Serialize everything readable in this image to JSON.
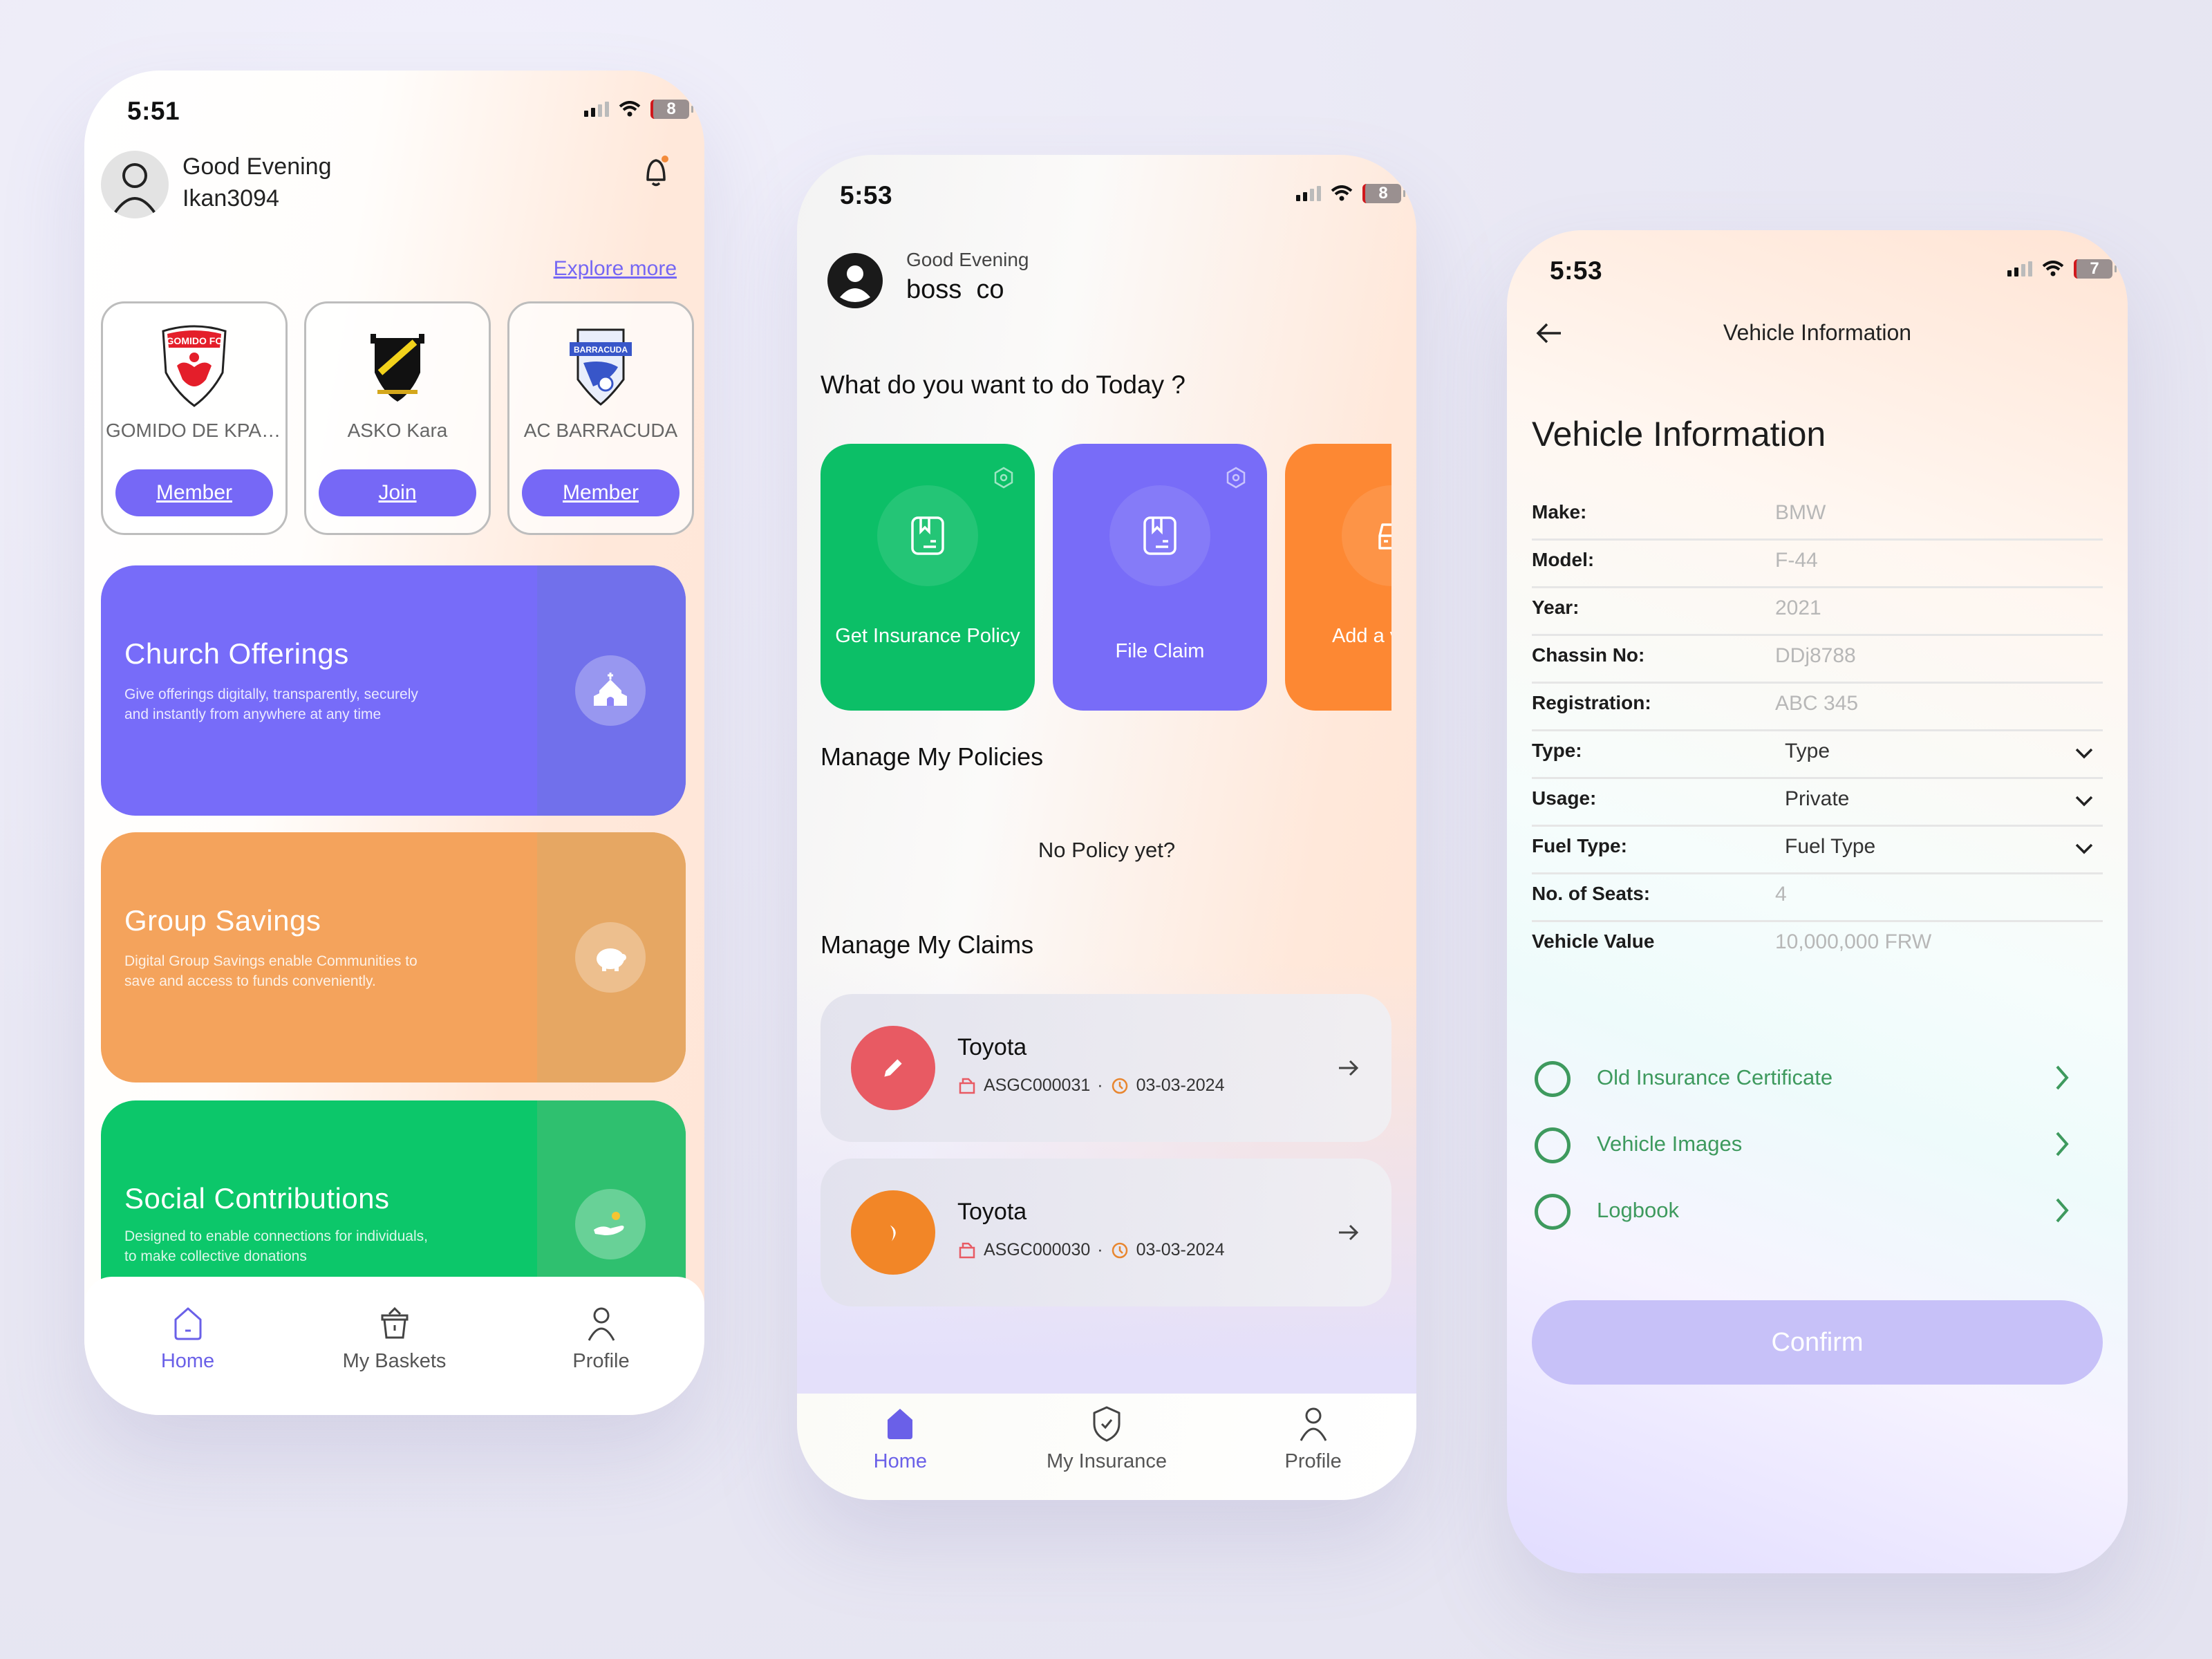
{
  "colors": {
    "accent_purple": "#7668f6",
    "green": "#0cc76a",
    "orange": "#f4a35c",
    "orange_action": "#fd8833",
    "claim_red": "#e85a63",
    "claim_orange": "#f28627",
    "doc_green": "#3e9a5e",
    "confirm_disabled": "#c7c1f8"
  },
  "phone1": {
    "status": {
      "time": "5:51",
      "battery": "8"
    },
    "greeting": "Good Evening",
    "username": "Ikan3094",
    "icons": {
      "avatar": "user-icon",
      "notifications": "bell-icon"
    },
    "explore_more": "Explore more",
    "teams": [
      {
        "name": "GOMIDO DE KPALIME",
        "action": "Member",
        "logo": "gomido-fc-logo"
      },
      {
        "name": "ASKO Kara",
        "action": "Join",
        "logo": "asko-kara-logo"
      },
      {
        "name": "AC BARRACUDA",
        "action": "Member",
        "logo": "ac-barracuda-logo"
      }
    ],
    "features": [
      {
        "title": "Church Offerings",
        "description": "Give offerings digitally, transparently, securely and instantly from anywhere at any time",
        "icon": "church-icon"
      },
      {
        "title": "Group Savings",
        "description": "Digital Group Savings enable Communities to save and access to funds conveniently.",
        "icon": "piggy-bank-icon"
      },
      {
        "title": "Social Contributions",
        "description": "Designed to enable connections for individuals, to make collective donations",
        "icon": "hand-coin-icon"
      }
    ],
    "tabs": [
      {
        "label": "Home",
        "icon": "home-icon",
        "active": true
      },
      {
        "label": "My Baskets",
        "icon": "basket-icon",
        "active": false
      },
      {
        "label": "Profile",
        "icon": "profile-icon",
        "active": false
      }
    ]
  },
  "phone2": {
    "status": {
      "time": "5:53",
      "battery": "8"
    },
    "greeting": "Good Evening",
    "username": "boss  co",
    "question": "What do you want to do Today ?",
    "actions": [
      {
        "label": "Get Insurance Policy",
        "icon": "document-bookmark-icon"
      },
      {
        "label": "File Claim",
        "icon": "document-bookmark-icon"
      },
      {
        "label": "Add a vehicle",
        "icon": "car-icon"
      }
    ],
    "policies_title": "Manage My Policies",
    "policies_empty": "No Policy yet?",
    "claims_title": "Manage My Claims",
    "claims": [
      {
        "vehicle": "Toyota",
        "code": "ASGC000031",
        "date": "03-03-2024",
        "status_icon": "pencil-icon"
      },
      {
        "vehicle": "Toyota",
        "code": "ASGC000030",
        "date": "03-03-2024",
        "status_icon": "pending-icon"
      }
    ],
    "tabs": [
      {
        "label": "Home",
        "icon": "home-icon",
        "active": true
      },
      {
        "label": "My Insurance",
        "icon": "shield-check-icon",
        "active": false
      },
      {
        "label": "Profile",
        "icon": "profile-icon",
        "active": false
      }
    ]
  },
  "phone3": {
    "status": {
      "time": "5:53",
      "battery": "7"
    },
    "nav_title": "Vehicle Information",
    "page_title": "Vehicle Information",
    "fields": [
      {
        "label": "Make:",
        "value": "BMW",
        "type": "text"
      },
      {
        "label": "Model:",
        "value": "F-44",
        "type": "text"
      },
      {
        "label": "Year:",
        "value": "2021",
        "type": "text"
      },
      {
        "label": "Chassin No:",
        "value": "DDj8788",
        "type": "text"
      },
      {
        "label": "Registration:",
        "value": "ABC 345",
        "type": "text"
      },
      {
        "label": "Type:",
        "value": "Type",
        "type": "select"
      },
      {
        "label": "Usage:",
        "value": "Private",
        "type": "select"
      },
      {
        "label": "Fuel Type:",
        "value": "Fuel Type",
        "type": "select"
      },
      {
        "label": "No. of Seats:",
        "value": "4",
        "type": "text"
      },
      {
        "label": "Vehicle Value",
        "value": "10,000,000 FRW",
        "type": "text"
      }
    ],
    "documents": [
      {
        "label": "Old Insurance Certificate"
      },
      {
        "label": "Vehicle Images"
      },
      {
        "label": "Logbook"
      }
    ],
    "confirm": "Confirm"
  }
}
